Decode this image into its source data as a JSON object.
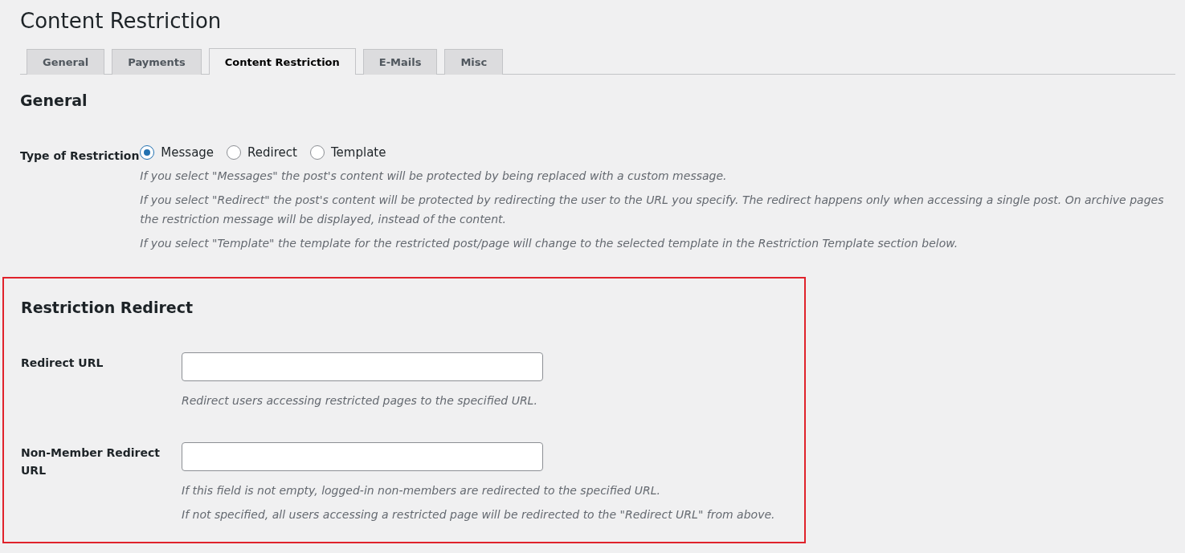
{
  "page_title": "Content Restriction",
  "tabs": [
    {
      "label": "General",
      "selected": false
    },
    {
      "label": "Payments",
      "selected": false
    },
    {
      "label": "Content Restriction",
      "selected": true
    },
    {
      "label": "E-Mails",
      "selected": false
    },
    {
      "label": "Misc",
      "selected": false
    }
  ],
  "general": {
    "heading": "General",
    "type_of_restriction": {
      "label": "Type of Restriction",
      "options": [
        {
          "label": "Message",
          "selected": true
        },
        {
          "label": "Redirect",
          "selected": false
        },
        {
          "label": "Template",
          "selected": false
        }
      ],
      "descriptions": [
        "If you select \"Messages\" the post's content will be protected by being replaced with a custom message.",
        "If you select \"Redirect\" the post's content will be protected by redirecting the user to the URL you specify. The redirect happens only when accessing a single post. On archive pages the restriction message will be displayed, instead of the content.",
        "If you select \"Template\" the template for the restricted post/page will change to the selected template in the Restriction Template section below."
      ]
    }
  },
  "restriction_redirect": {
    "highlighted": true,
    "heading": "Restriction Redirect",
    "fields": [
      {
        "label": "Redirect URL",
        "descriptions": [
          "Redirect users accessing restricted pages to the specified URL."
        ]
      },
      {
        "label": "Non-Member Redirect URL",
        "descriptions": [
          "If this field is not empty, logged-in non-members are redirected to the specified URL.",
          "If not specified, all users accessing a restricted page will be redirected to the \"Redirect URL\" from above."
        ]
      }
    ]
  }
}
